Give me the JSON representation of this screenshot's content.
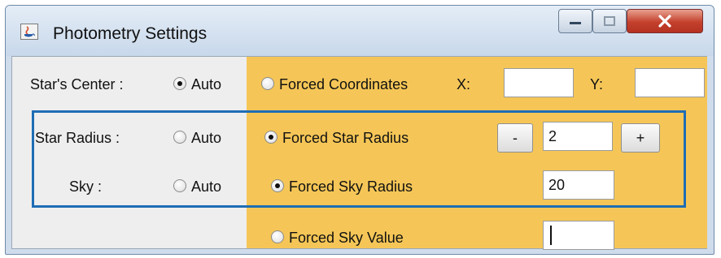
{
  "window": {
    "title": "Photometry Settings",
    "app_icon": "java-icon",
    "controls": {
      "minimize": "minimize-icon",
      "maximize": "maximize-icon",
      "close": "close-icon"
    }
  },
  "colors": {
    "panel": "#eeeeee",
    "accent": "#f5c657",
    "highlight_border": "#1f6db5",
    "close": "#c4402c"
  },
  "rows": {
    "star_center": {
      "label": "Star's Center :",
      "auto_label": "Auto",
      "auto_selected": true,
      "forced_label": "Forced Coordinates",
      "forced_selected": false,
      "x_label": "X:",
      "x_value": "",
      "y_label": "Y:",
      "y_value": ""
    },
    "star_radius": {
      "label": "Star Radius :",
      "auto_label": "Auto",
      "auto_selected": false,
      "forced_label": "Forced Star Radius",
      "forced_selected": true,
      "decrement_label": "-",
      "value": "2",
      "increment_label": "+"
    },
    "sky": {
      "label": "Sky :",
      "auto_label": "Auto",
      "auto_selected": false,
      "forced_label": "Forced Sky Radius",
      "forced_selected": true,
      "value": "20"
    },
    "sky_value": {
      "forced_label": "Forced Sky Value",
      "forced_selected": false,
      "value": ""
    }
  }
}
